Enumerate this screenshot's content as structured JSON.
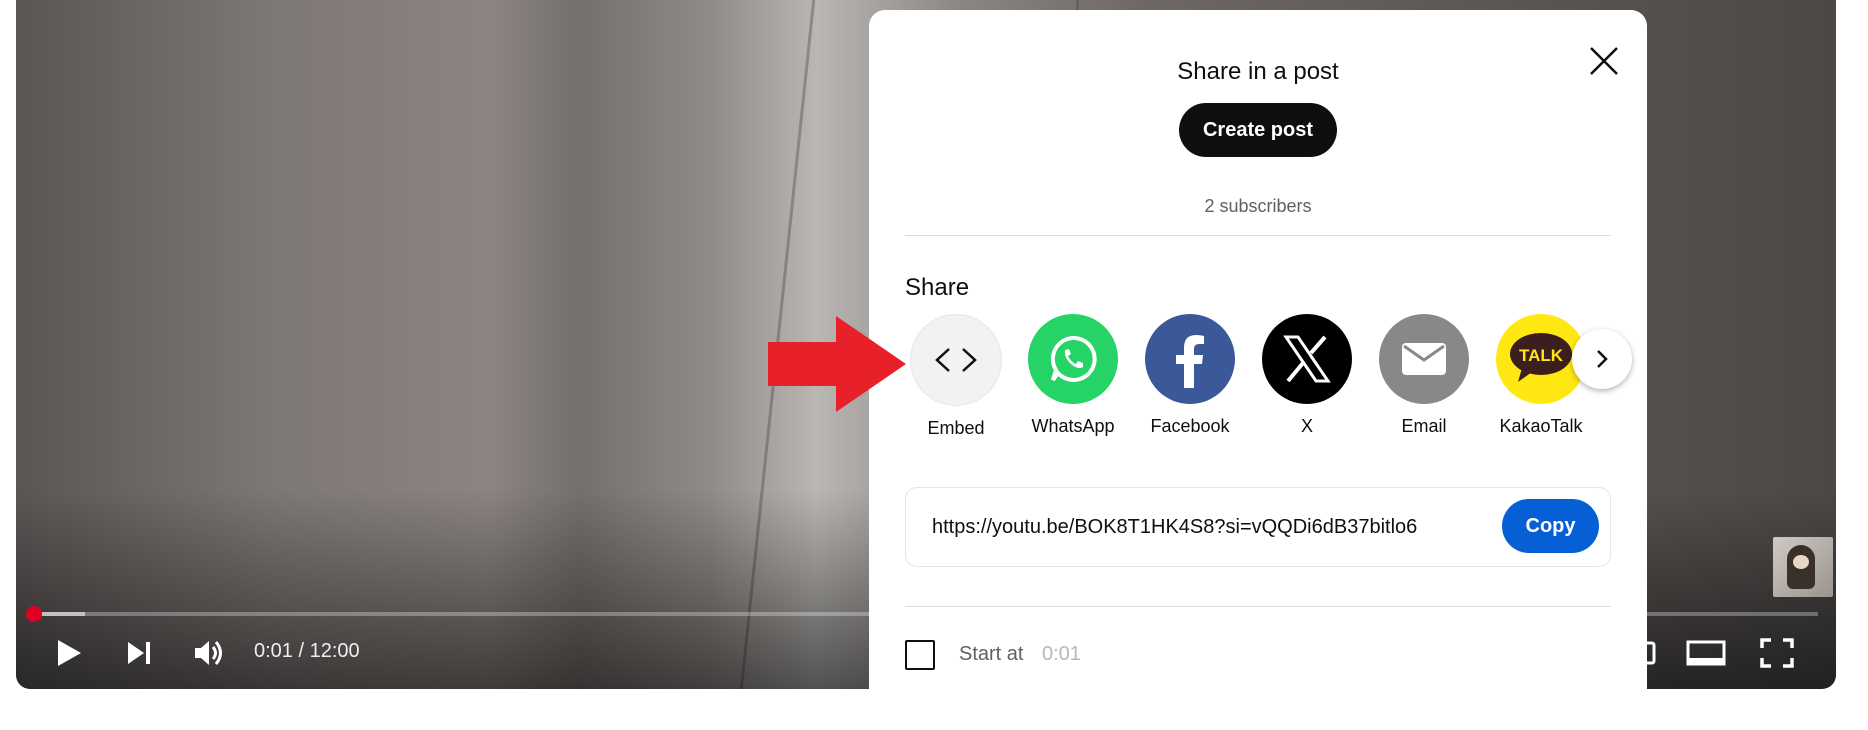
{
  "player": {
    "time_display": "0:01 / 12:00",
    "progress_fraction": 0.0001,
    "buttons": [
      {
        "name": "play-button",
        "icon": "play-icon"
      },
      {
        "name": "next-button",
        "icon": "skip-next-icon"
      },
      {
        "name": "mute-button",
        "icon": "volume-icon"
      },
      {
        "name": "theater-mode-button",
        "icon": "theater-icon"
      },
      {
        "name": "fullscreen-button",
        "icon": "fullscreen-icon"
      }
    ],
    "accent_color": "#e00024"
  },
  "dialog": {
    "post_title": "Share in a post",
    "create_post_label": "Create post",
    "subscribers": "2 subscribers",
    "share_label": "Share",
    "targets": [
      {
        "label": "Embed",
        "icon": "embed-code-icon",
        "color": "#f2f2f2"
      },
      {
        "label": "WhatsApp",
        "icon": "whatsapp-icon",
        "color": "#25d366"
      },
      {
        "label": "Facebook",
        "icon": "facebook-icon",
        "color": "#3b5998"
      },
      {
        "label": "X",
        "icon": "x-logo-icon",
        "color": "#000000"
      },
      {
        "label": "Email",
        "icon": "email-icon",
        "color": "#888888"
      },
      {
        "label": "KakaoTalk",
        "icon": "kakaotalk-icon",
        "color": "#ffe812",
        "badge": "TALK"
      }
    ],
    "link": "https://youtu.be/BOK8T1HK4S8?si=vQQDi6dB37bitlo6",
    "copy_label": "Copy",
    "start_at_label": "Start at",
    "start_at_time": "0:01",
    "start_at_checked": false,
    "copy_color": "#065fd4"
  },
  "annotation": {
    "arrow_color": "#e8202a"
  }
}
